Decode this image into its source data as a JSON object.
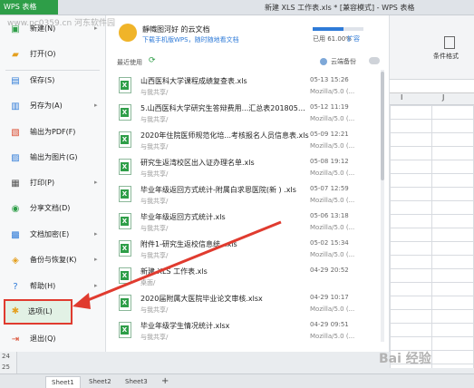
{
  "app": {
    "wps_label": "WPS 表格",
    "doc_title": "新建 XLS 工作表.xls * [兼容模式] - WPS 表格"
  },
  "ribbon": {
    "cond_format_label": "条件格式"
  },
  "columns": [
    "I",
    "J"
  ],
  "rows": [
    "24",
    "25"
  ],
  "sheet_tabs": [
    "Sheet1",
    "Sheet2",
    "Sheet3"
  ],
  "menu": {
    "items": [
      {
        "label": "新建(N)",
        "icon": "new-doc-icon",
        "has_arrow": true
      },
      {
        "label": "打开(O)",
        "icon": "open-folder-icon",
        "has_arrow": false
      },
      {
        "label": "保存(S)",
        "icon": "save-icon",
        "has_arrow": false
      },
      {
        "label": "另存为(A)",
        "icon": "save-as-icon",
        "has_arrow": true
      },
      {
        "label": "输出为PDF(F)",
        "icon": "pdf-icon",
        "has_arrow": false
      },
      {
        "label": "输出为图片(G)",
        "icon": "image-export-icon",
        "has_arrow": false
      },
      {
        "label": "打印(P)",
        "icon": "print-icon",
        "has_arrow": true
      },
      {
        "label": "分享文档(D)",
        "icon": "share-icon",
        "has_arrow": false
      },
      {
        "label": "文档加密(E)",
        "icon": "encrypt-icon",
        "has_arrow": true
      },
      {
        "label": "备份与恢复(K)",
        "icon": "backup-icon",
        "has_arrow": true
      },
      {
        "label": "帮助(H)",
        "icon": "help-icon",
        "has_arrow": true
      },
      {
        "label": "选项(L)",
        "icon": "gear-icon",
        "has_arrow": false
      },
      {
        "label": "退出(Q)",
        "icon": "exit-icon",
        "has_arrow": false
      }
    ]
  },
  "account": {
    "user": "靜幟图河好 的云文档",
    "download_tip": "下载手机版WPS，随时随地看文档",
    "storage_used": "已用 61.00%",
    "storage_fraction": 0.61,
    "expand": "扩容"
  },
  "recent": {
    "label": "最近使用",
    "backup_label": "云端备份"
  },
  "files": [
    {
      "name": "山西医科大学课程成绩复查表.xls",
      "sub": "与我共享/",
      "date": "05-13 15:26",
      "agent": "Mozilla/5.0 (..."
    },
    {
      "name": "5.山西医科大学研究生答辩费用...汇总表20180519.xls",
      "sub": "与我共享/",
      "date": "05-12 11:19",
      "agent": "Mozilla/5.0 (..."
    },
    {
      "name": "2020年住院医师规范化培...考核报名人员信息表.xls",
      "sub": "与我共享/",
      "date": "05-09 12:21",
      "agent": "Mozilla/5.0 (..."
    },
    {
      "name": "研究生返湾校区出入证办理名单.xls",
      "sub": "与我共享/",
      "date": "05-08 19:12",
      "agent": "Mozilla/5.0 (..."
    },
    {
      "name": "毕业年级返回方式统计-附属白求恩医院(新 ) .xls",
      "sub": "与我共享/",
      "date": "05-07 12:59",
      "agent": "Mozilla/5.0 (..."
    },
    {
      "name": "毕业年级返回方式统计.xls",
      "sub": "与我共享/",
      "date": "05-06 13:18",
      "agent": "Mozilla/5.0 (..."
    },
    {
      "name": "附件1-研究生返校信息统...xls",
      "sub": "与我共享/",
      "date": "05-02 15:34",
      "agent": "Mozilla/5.0 (..."
    },
    {
      "name": "新建 XLS 工作表.xls",
      "sub": "桌面/",
      "date": "04-29 20:52",
      "agent": ""
    },
    {
      "name": "2020届附属大医院毕业论文审核.xlsx",
      "sub": "与我共享/",
      "date": "04-29 10:17",
      "agent": "Mozilla/5.0 (..."
    },
    {
      "name": "毕业年级学生情况统计.xlsx",
      "sub": "与我共享/",
      "date": "04-29 09:51",
      "agent": "Mozilla/5.0 (..."
    }
  ],
  "watermark": "Bai 经验",
  "site_watermark": "www.pc0359.cn 河东软件园"
}
